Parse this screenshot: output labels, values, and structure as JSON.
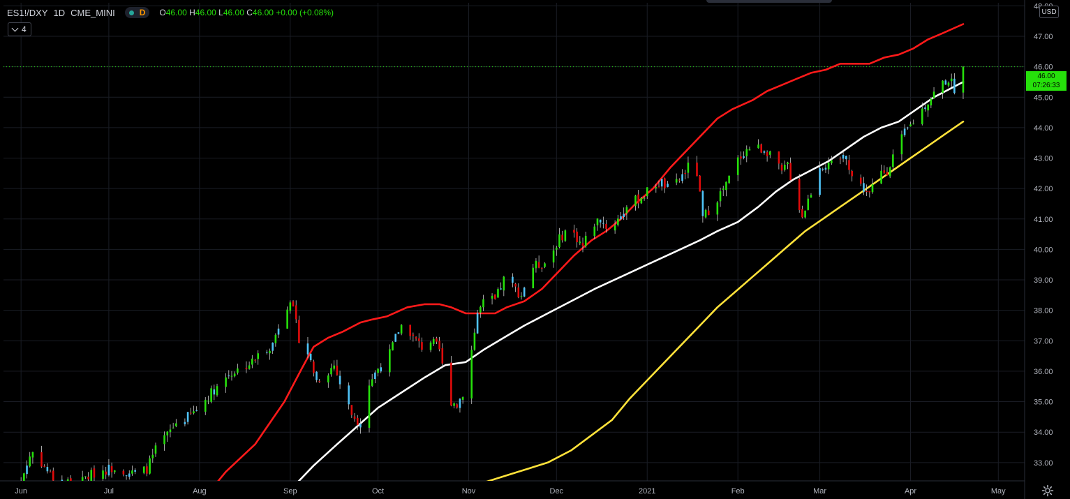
{
  "legend": {
    "symbol": "ES1!/DXY",
    "interval": "1D",
    "exchange": "CME_MINI",
    "status_letter": "D",
    "o_label": "O",
    "o_value": "46.00",
    "h_label": "H",
    "h_value": "46.00",
    "l_label": "L",
    "l_value": "46.00",
    "c_label": "C",
    "c_value": "46.00",
    "change": "+0.00 (+0.08%)"
  },
  "collapse_count": "4",
  "currency": "USD",
  "last_price": {
    "value": "46.00",
    "countdown": "07:26:33"
  },
  "colors": {
    "up": "#26e00b",
    "down": "#e00b0b",
    "neutral_up": "#4fc3f7",
    "wick": "#cfcfcf",
    "ma_red": "#ff1a1a",
    "ma_white": "#ffffff",
    "ma_yellow": "#ffe23a",
    "grid": "#1a1d25",
    "axis_text": "#b2b5be",
    "background": "#000000"
  },
  "chart_data": {
    "type": "line",
    "subtype": "candlestick with moving averages",
    "title": "ES1!/DXY",
    "xlabel": "",
    "ylabel": "",
    "ylim": [
      32.4,
      48.1
    ],
    "y_ticks": [
      "33.00",
      "34.00",
      "35.00",
      "36.00",
      "37.00",
      "38.00",
      "39.00",
      "40.00",
      "41.00",
      "42.00",
      "43.00",
      "44.00",
      "45.00",
      "46.00",
      "47.00",
      "48.00"
    ],
    "x_ticks": [
      "Jun",
      "Jul",
      "Aug",
      "Sep",
      "Oct",
      "Nov",
      "Dec",
      "2021",
      "Feb",
      "Mar",
      "Apr",
      "May"
    ],
    "x_tick_positions": [
      0,
      30,
      61,
      92,
      122,
      153,
      183,
      214,
      245,
      273,
      304,
      334
    ],
    "x_domain": [
      -6,
      343
    ],
    "grid": true,
    "last_price_line": 46.0,
    "anchor_closes": [
      [
        0,
        32.4
      ],
      [
        3,
        33.2
      ],
      [
        5,
        33.5
      ],
      [
        7,
        33.0
      ],
      [
        10,
        32.6
      ],
      [
        13,
        32.3
      ],
      [
        16,
        32.4
      ],
      [
        19,
        32.2
      ],
      [
        22,
        32.5
      ],
      [
        26,
        32.7
      ],
      [
        30,
        32.8
      ],
      [
        33,
        32.9
      ],
      [
        36,
        32.7
      ],
      [
        40,
        32.6
      ],
      [
        43,
        32.8
      ],
      [
        47,
        33.6
      ],
      [
        50,
        33.9
      ],
      [
        53,
        34.3
      ],
      [
        57,
        34.5
      ],
      [
        61,
        34.8
      ],
      [
        64,
        35.2
      ],
      [
        68,
        35.6
      ],
      [
        71,
        35.9
      ],
      [
        75,
        36.1
      ],
      [
        79,
        36.3
      ],
      [
        82,
        36.6
      ],
      [
        86,
        36.9
      ],
      [
        89,
        37.8
      ],
      [
        92,
        38.4
      ],
      [
        95,
        37.1
      ],
      [
        98,
        36.6
      ],
      [
        101,
        35.7
      ],
      [
        104,
        35.9
      ],
      [
        107,
        36.2
      ],
      [
        110,
        35.3
      ],
      [
        113,
        34.6
      ],
      [
        116,
        34.3
      ],
      [
        119,
        35.6
      ],
      [
        122,
        36.1
      ],
      [
        125,
        36.3
      ],
      [
        128,
        37.1
      ],
      [
        131,
        37.7
      ],
      [
        134,
        37.1
      ],
      [
        137,
        36.8
      ],
      [
        140,
        37.0
      ],
      [
        143,
        36.7
      ],
      [
        146,
        35.1
      ],
      [
        149,
        34.9
      ],
      [
        152,
        35.5
      ],
      [
        154,
        36.7
      ],
      [
        156,
        37.9
      ],
      [
        159,
        38.4
      ],
      [
        162,
        38.3
      ],
      [
        165,
        39.0
      ],
      [
        168,
        38.8
      ],
      [
        171,
        38.5
      ],
      [
        174,
        39.4
      ],
      [
        177,
        39.5
      ],
      [
        180,
        39.6
      ],
      [
        183,
        40.2
      ],
      [
        186,
        40.6
      ],
      [
        189,
        40.5
      ],
      [
        192,
        40.1
      ],
      [
        195,
        40.8
      ],
      [
        198,
        41.0
      ],
      [
        201,
        40.6
      ],
      [
        204,
        41.0
      ],
      [
        207,
        41.4
      ],
      [
        210,
        41.6
      ],
      [
        213,
        41.8
      ],
      [
        216,
        42.1
      ],
      [
        219,
        42.2
      ],
      [
        222,
        41.9
      ],
      [
        225,
        42.3
      ],
      [
        228,
        42.7
      ],
      [
        231,
        42.5
      ],
      [
        233,
        41.0
      ],
      [
        235,
        41.3
      ],
      [
        238,
        41.7
      ],
      [
        241,
        42.1
      ],
      [
        244,
        42.8
      ],
      [
        247,
        43.2
      ],
      [
        250,
        43.4
      ],
      [
        253,
        43.3
      ],
      [
        256,
        43.2
      ],
      [
        258,
        42.8
      ],
      [
        260,
        42.5
      ],
      [
        262,
        42.8
      ],
      [
        264,
        42.0
      ],
      [
        267,
        41.1
      ],
      [
        270,
        41.9
      ],
      [
        273,
        42.8
      ],
      [
        276,
        42.7
      ],
      [
        279,
        42.9
      ],
      [
        282,
        43.1
      ],
      [
        284,
        42.4
      ],
      [
        287,
        42.1
      ],
      [
        290,
        41.8
      ],
      [
        293,
        42.5
      ],
      [
        296,
        42.6
      ],
      [
        299,
        43.3
      ],
      [
        302,
        43.8
      ],
      [
        305,
        44.2
      ],
      [
        308,
        44.6
      ],
      [
        311,
        45.0
      ],
      [
        314,
        45.4
      ],
      [
        317,
        45.6
      ],
      [
        319,
        45.3
      ],
      [
        321,
        45.5
      ],
      [
        322,
        46.0
      ]
    ],
    "series": [
      {
        "type": "candlestick",
        "start_close": 32.4,
        "end_close": 46.0
      },
      {
        "type": "line",
        "color": "red",
        "values": [
          [
            64,
            32.0
          ],
          [
            70,
            32.7
          ],
          [
            80,
            33.6
          ],
          [
            90,
            35.0
          ],
          [
            96,
            36.1
          ],
          [
            100,
            36.8
          ],
          [
            105,
            37.1
          ],
          [
            110,
            37.3
          ],
          [
            116,
            37.6
          ],
          [
            120,
            37.7
          ],
          [
            125,
            37.8
          ],
          [
            132,
            38.1
          ],
          [
            138,
            38.2
          ],
          [
            143,
            38.2
          ],
          [
            147,
            38.1
          ],
          [
            152,
            37.9
          ],
          [
            158,
            37.9
          ],
          [
            162,
            37.9
          ],
          [
            166,
            38.1
          ],
          [
            172,
            38.3
          ],
          [
            178,
            38.7
          ],
          [
            183,
            39.2
          ],
          [
            189,
            39.8
          ],
          [
            195,
            40.3
          ],
          [
            200,
            40.6
          ],
          [
            205,
            41.0
          ],
          [
            210,
            41.5
          ],
          [
            216,
            42.0
          ],
          [
            222,
            42.7
          ],
          [
            226,
            43.1
          ],
          [
            230,
            43.5
          ],
          [
            234,
            43.9
          ],
          [
            238,
            44.3
          ],
          [
            243,
            44.6
          ],
          [
            250,
            44.9
          ],
          [
            255,
            45.2
          ],
          [
            260,
            45.4
          ],
          [
            265,
            45.6
          ],
          [
            270,
            45.8
          ],
          [
            275,
            45.9
          ],
          [
            280,
            46.1
          ],
          [
            285,
            46.1
          ],
          [
            290,
            46.1
          ],
          [
            295,
            46.3
          ],
          [
            300,
            46.4
          ],
          [
            305,
            46.6
          ],
          [
            310,
            46.9
          ],
          [
            315,
            47.1
          ],
          [
            322,
            47.4
          ]
        ]
      },
      {
        "type": "line",
        "color": "white",
        "values": [
          [
            92,
            32.1
          ],
          [
            100,
            32.9
          ],
          [
            108,
            33.6
          ],
          [
            115,
            34.2
          ],
          [
            122,
            34.8
          ],
          [
            130,
            35.3
          ],
          [
            138,
            35.8
          ],
          [
            145,
            36.2
          ],
          [
            152,
            36.3
          ],
          [
            158,
            36.7
          ],
          [
            165,
            37.1
          ],
          [
            172,
            37.5
          ],
          [
            180,
            37.9
          ],
          [
            188,
            38.3
          ],
          [
            196,
            38.7
          ],
          [
            205,
            39.1
          ],
          [
            214,
            39.5
          ],
          [
            223,
            39.9
          ],
          [
            232,
            40.3
          ],
          [
            238,
            40.6
          ],
          [
            245,
            40.9
          ],
          [
            252,
            41.4
          ],
          [
            258,
            41.9
          ],
          [
            264,
            42.3
          ],
          [
            270,
            42.6
          ],
          [
            276,
            42.9
          ],
          [
            282,
            43.3
          ],
          [
            288,
            43.7
          ],
          [
            294,
            44.0
          ],
          [
            300,
            44.2
          ],
          [
            306,
            44.6
          ],
          [
            312,
            45.0
          ],
          [
            322,
            45.5
          ]
        ]
      },
      {
        "type": "line",
        "color": "yellow",
        "values": [
          [
            143,
            31.9
          ],
          [
            150,
            32.1
          ],
          [
            160,
            32.4
          ],
          [
            170,
            32.7
          ],
          [
            180,
            33.0
          ],
          [
            188,
            33.4
          ],
          [
            195,
            33.9
          ],
          [
            202,
            34.4
          ],
          [
            208,
            35.1
          ],
          [
            214,
            35.7
          ],
          [
            220,
            36.3
          ],
          [
            226,
            36.9
          ],
          [
            232,
            37.5
          ],
          [
            238,
            38.1
          ],
          [
            244,
            38.6
          ],
          [
            250,
            39.1
          ],
          [
            256,
            39.6
          ],
          [
            262,
            40.1
          ],
          [
            268,
            40.6
          ],
          [
            274,
            41.0
          ],
          [
            280,
            41.4
          ],
          [
            286,
            41.8
          ],
          [
            292,
            42.2
          ],
          [
            298,
            42.6
          ],
          [
            304,
            43.0
          ],
          [
            310,
            43.4
          ],
          [
            316,
            43.8
          ],
          [
            322,
            44.2
          ]
        ]
      }
    ]
  }
}
